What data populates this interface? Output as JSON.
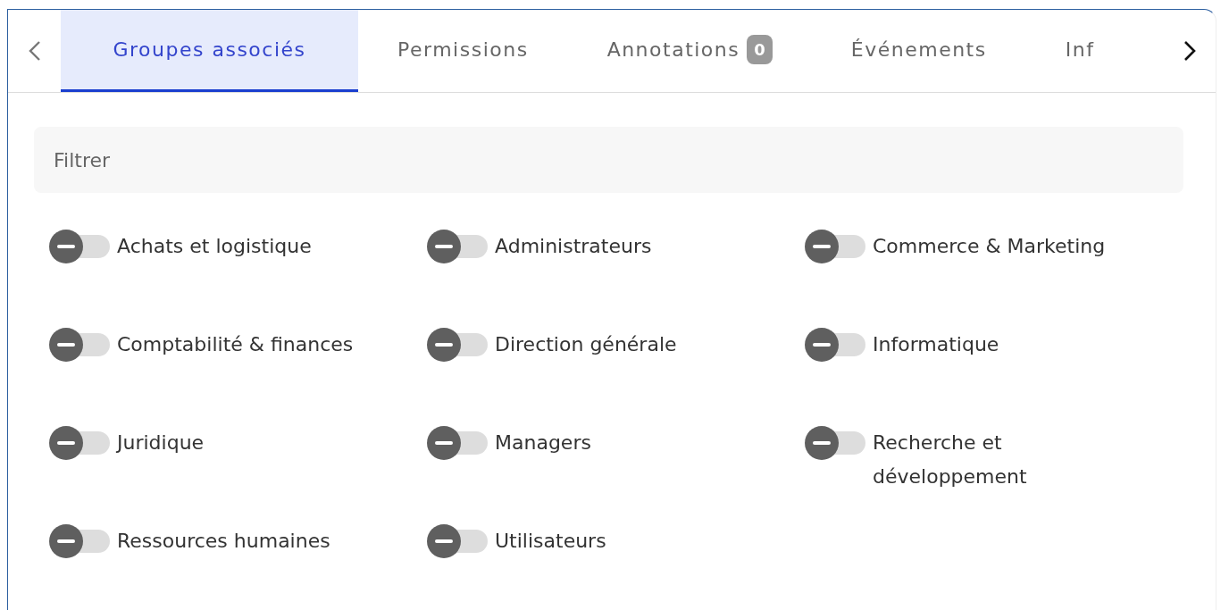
{
  "tabs": [
    {
      "label": "Groupes associés",
      "selected": true
    },
    {
      "label": "Permissions",
      "selected": false
    },
    {
      "label": "Annotations",
      "selected": false,
      "badge": "0"
    },
    {
      "label": "Événements",
      "selected": false
    },
    {
      "label": "Inf",
      "selected": false
    }
  ],
  "filter": {
    "placeholder": "Filtrer"
  },
  "groups": [
    {
      "label": "Achats et logistique",
      "on": false
    },
    {
      "label": "Administrateurs",
      "on": false
    },
    {
      "label": "Commerce & Marketing",
      "on": false
    },
    {
      "label": "Comptabilité & finances",
      "on": false
    },
    {
      "label": "Direction générale",
      "on": false
    },
    {
      "label": "Informatique",
      "on": false
    },
    {
      "label": "Juridique",
      "on": false
    },
    {
      "label": "Managers",
      "on": false
    },
    {
      "label": "Recherche et développement",
      "on": false
    },
    {
      "label": "Ressources humaines",
      "on": false
    },
    {
      "label": "Utilisateurs",
      "on": false
    }
  ]
}
